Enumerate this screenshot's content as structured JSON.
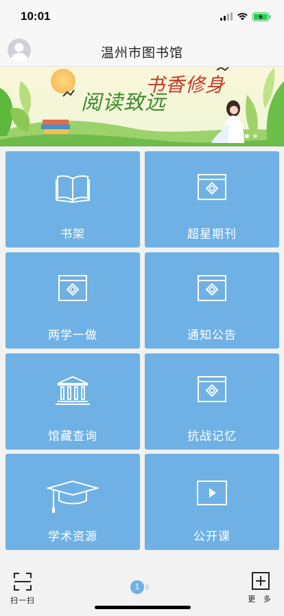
{
  "status_bar": {
    "time": "10:01",
    "battery_color": "#34c759"
  },
  "header": {
    "title": "温州市图书馆",
    "avatar_icon": "user-avatar-icon"
  },
  "banner": {
    "line1": "阅读致远",
    "line2": "书香修身",
    "page_indicator": "active-dot"
  },
  "tiles": [
    {
      "label": "书架",
      "icon": "open-book-icon"
    },
    {
      "label": "超星期刊",
      "icon": "journal-frame-icon"
    },
    {
      "label": "两学一做",
      "icon": "journal-frame-icon"
    },
    {
      "label": "通知公告",
      "icon": "journal-frame-icon"
    },
    {
      "label": "馆藏查询",
      "icon": "library-building-icon"
    },
    {
      "label": "抗战记忆",
      "icon": "journal-frame-icon"
    },
    {
      "label": "学术资源",
      "icon": "graduation-cap-icon"
    },
    {
      "label": "公开课",
      "icon": "video-play-icon"
    }
  ],
  "bottom_bar": {
    "scan_label": "扫一扫",
    "more_label": "更 多",
    "current_page": "1"
  },
  "colors": {
    "tile_bg": "#6fb1e4",
    "page_bg": "#f2f2f2"
  }
}
